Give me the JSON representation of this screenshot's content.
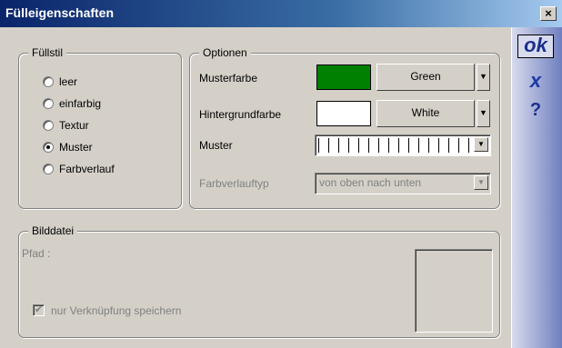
{
  "window": {
    "title": "Fülleigenschaften",
    "close_label": "×"
  },
  "side_buttons": {
    "ok": "ok",
    "cancel": "x",
    "help": "?"
  },
  "fuellstil": {
    "legend": "Füllstil",
    "options": [
      {
        "label": "leer",
        "selected": false
      },
      {
        "label": "einfarbig",
        "selected": false
      },
      {
        "label": "Textur",
        "selected": false
      },
      {
        "label": "Muster",
        "selected": true
      },
      {
        "label": "Farbverlauf",
        "selected": false
      }
    ]
  },
  "optionen": {
    "legend": "Optionen",
    "musterfarbe": {
      "label": "Musterfarbe",
      "color": "#008000",
      "value": "Green"
    },
    "hintergrundfarbe": {
      "label": "Hintergrundfarbe",
      "color": "#ffffff",
      "value": "White"
    },
    "muster": {
      "label": "Muster"
    },
    "farbverlauftyp": {
      "label": "Farbverlauftyp",
      "value": "von oben nach unten"
    }
  },
  "bilddatei": {
    "legend": "Bilddatei",
    "pfad_label": "Pfad :",
    "checkbox_label": "nur Verknüpfung speichern",
    "checkbox_checked": true
  },
  "colors": {
    "accent": "#0a246a",
    "face": "#d4d0c8"
  }
}
